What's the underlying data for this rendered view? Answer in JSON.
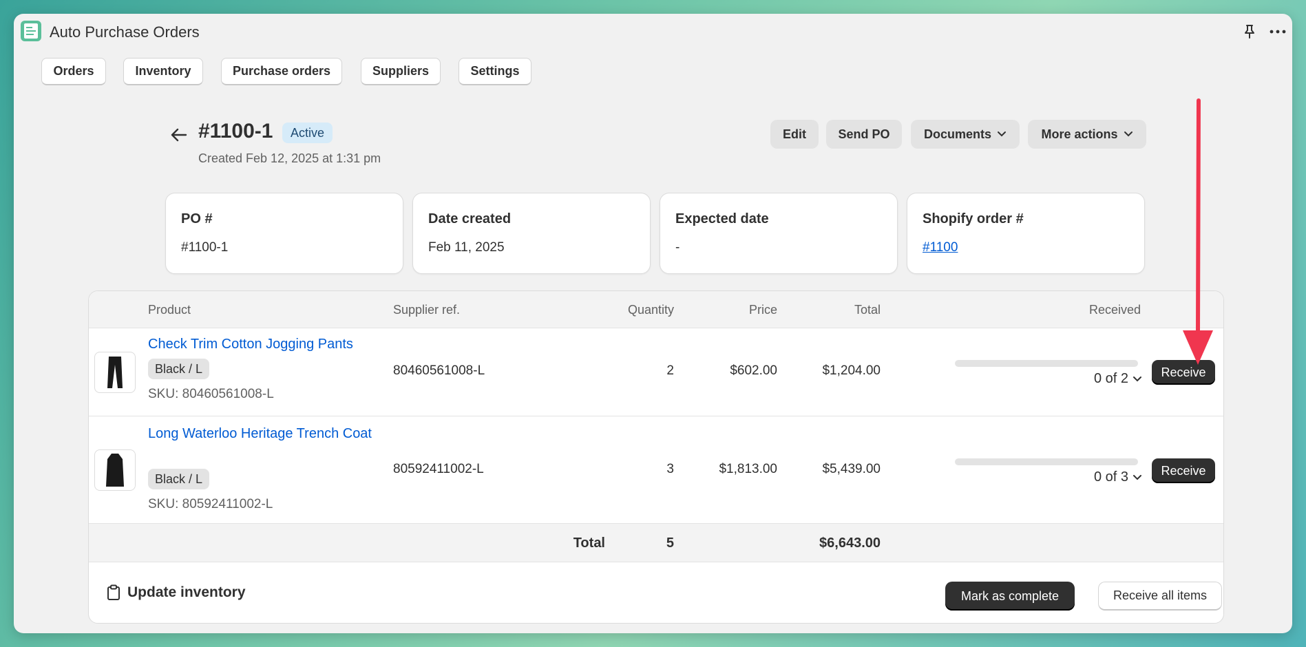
{
  "app": {
    "title": "Auto Purchase Orders"
  },
  "nav": [
    "Orders",
    "Inventory",
    "Purchase orders",
    "Suppliers",
    "Settings"
  ],
  "po": {
    "title": "#1100-1",
    "status": "Active",
    "created": "Created Feb 12, 2025 at 1:31 pm"
  },
  "actions": {
    "edit": "Edit",
    "send": "Send PO",
    "documents": "Documents",
    "more": "More actions"
  },
  "cards": [
    {
      "label": "PO #",
      "value": "#1100-1"
    },
    {
      "label": "Date created",
      "value": "Feb 11, 2025"
    },
    {
      "label": "Expected date",
      "value": "-"
    },
    {
      "label": "Shopify order #",
      "value": "#1100"
    }
  ],
  "table": {
    "headers": {
      "product": "Product",
      "supplier_ref": "Supplier ref.",
      "quantity": "Quantity",
      "price": "Price",
      "total": "Total",
      "received": "Received"
    },
    "rows": [
      {
        "name": "Check Trim Cotton Jogging Pants",
        "variant": "Black / L",
        "sku": "SKU: 80460561008-L",
        "supplier_ref": "80460561008-L",
        "quantity": "2",
        "price": "$602.00",
        "total": "$1,204.00",
        "received_fraction": 0,
        "received": "0 of 2",
        "action": "Receive"
      },
      {
        "name": "Long Waterloo Heritage Trench Coat",
        "variant": "Black / L",
        "sku": "SKU: 80592411002-L",
        "supplier_ref": "80592411002-L",
        "quantity": "3",
        "price": "$1,813.00",
        "total": "$5,439.00",
        "received_fraction": 0,
        "received": "0 of 3",
        "action": "Receive"
      }
    ],
    "totals": {
      "label": "Total",
      "quantity": "5",
      "total": "$6,643.00"
    }
  },
  "footer": {
    "update": "Update inventory",
    "mark_complete": "Mark as complete",
    "receive_all": "Receive all items"
  },
  "colors": {
    "link": "#005bd3",
    "annotation_arrow": "#f0364f",
    "active_badge": "#d6ebf9"
  }
}
